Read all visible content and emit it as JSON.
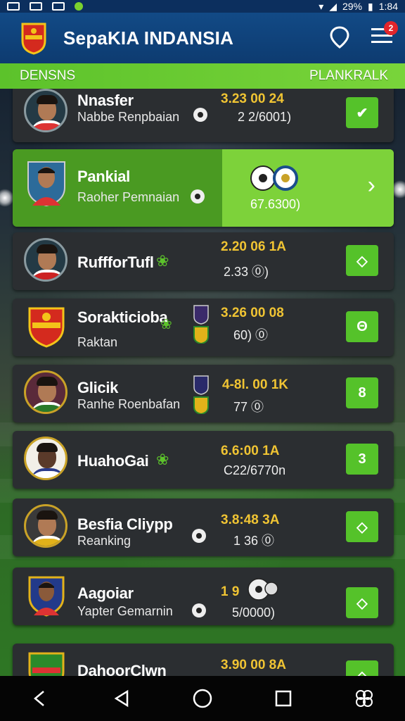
{
  "status_bar": {
    "battery": "29%",
    "time": "1:84"
  },
  "app": {
    "title": "SepaKIA INDANSIA",
    "notification_count": "2"
  },
  "tabs": {
    "left": "DENSNS",
    "right": "PLANKRALK"
  },
  "players": [
    {
      "name": "Nnasfer",
      "subtitle": "Nabbe Renpbaian",
      "stat_primary": "3.23 00 24",
      "stat_secondary": "2 2/6001)",
      "button": "✔"
    },
    {
      "name": "Pankial",
      "subtitle": "Raoher Pemnaian",
      "stat_primary": "",
      "stat_secondary": "67.6300)",
      "button": "›"
    },
    {
      "name": "RuffforTufl",
      "subtitle": "",
      "stat_primary": "2.20 06 1A",
      "stat_secondary": "2.33 ⓪)",
      "button": "◇"
    },
    {
      "name": "Sorakticioba",
      "subtitle": "Raktan",
      "stat_primary": "3.26 00 08",
      "stat_secondary": "60) ⓪",
      "button": "Θ"
    },
    {
      "name": "Glicik",
      "subtitle": "Ranhe Roenbafan",
      "stat_primary": "4-8l. 00 1K",
      "stat_secondary": "77 ⓪",
      "button": "8"
    },
    {
      "name": "HuahoGai",
      "subtitle": "",
      "stat_primary": "6.6:00 1A",
      "stat_secondary": "C22/6770n",
      "button": "3"
    },
    {
      "name": "Besfia Cliypp",
      "subtitle": "Reanking",
      "stat_primary": "3.8:48 3A",
      "stat_secondary": "1 36 ⓪",
      "button": "◇"
    },
    {
      "name": "Aagoiar",
      "subtitle": "Yapter Gemarnin",
      "stat_primary": "1 9",
      "stat_secondary": "5/0000)",
      "button": "◇"
    },
    {
      "name": "DahoorClwn",
      "subtitle": "",
      "stat_primary": "3.90 00 8A",
      "stat_secondary": "",
      "button": "◇"
    }
  ],
  "colors": {
    "brand_blue": "#0d3b70",
    "accent_green": "#5cc22b",
    "stat_yellow": "#f0c433",
    "card_bg": "#2b2e31"
  }
}
